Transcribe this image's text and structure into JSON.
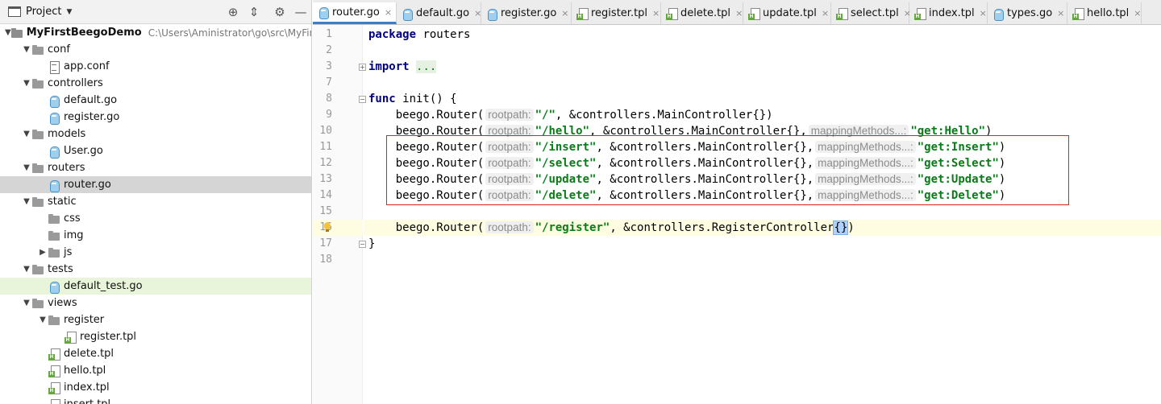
{
  "project_panel": {
    "title": "Project",
    "caret": "▼",
    "tools": [
      "⊕",
      "⇕",
      "⚙",
      "—"
    ]
  },
  "tree": [
    {
      "label": "MyFirstBeegoDemo",
      "path": "C:\\Users\\Aministrator\\go\\src\\MyFirstB",
      "indent": 0,
      "arrow": "▼",
      "icon": "root",
      "bold": true
    },
    {
      "label": "conf",
      "indent": 1,
      "arrow": "▼",
      "icon": "folder"
    },
    {
      "label": "app.conf",
      "indent": 2,
      "arrow": "",
      "icon": "conf"
    },
    {
      "label": "controllers",
      "indent": 1,
      "arrow": "▼",
      "icon": "folder"
    },
    {
      "label": "default.go",
      "indent": 2,
      "arrow": "",
      "icon": "go"
    },
    {
      "label": "register.go",
      "indent": 2,
      "arrow": "",
      "icon": "go"
    },
    {
      "label": "models",
      "indent": 1,
      "arrow": "▼",
      "icon": "folder"
    },
    {
      "label": "User.go",
      "indent": 2,
      "arrow": "",
      "icon": "go"
    },
    {
      "label": "routers",
      "indent": 1,
      "arrow": "▼",
      "icon": "folder"
    },
    {
      "label": "router.go",
      "indent": 2,
      "arrow": "",
      "icon": "go",
      "state": "selected"
    },
    {
      "label": "static",
      "indent": 1,
      "arrow": "▼",
      "icon": "folder"
    },
    {
      "label": "css",
      "indent": 2,
      "arrow": "",
      "icon": "folder"
    },
    {
      "label": "img",
      "indent": 2,
      "arrow": "",
      "icon": "folder"
    },
    {
      "label": "js",
      "indent": 2,
      "arrow": "▶",
      "icon": "folder"
    },
    {
      "label": "tests",
      "indent": 1,
      "arrow": "▼",
      "icon": "folder"
    },
    {
      "label": "default_test.go",
      "indent": 2,
      "arrow": "",
      "icon": "go",
      "state": "modified"
    },
    {
      "label": "views",
      "indent": 1,
      "arrow": "▼",
      "icon": "folder"
    },
    {
      "label": "register",
      "indent": 2,
      "arrow": "▼",
      "icon": "folder"
    },
    {
      "label": "register.tpl",
      "indent": 3,
      "arrow": "",
      "icon": "tpl"
    },
    {
      "label": "delete.tpl",
      "indent": 2,
      "arrow": "",
      "icon": "tpl"
    },
    {
      "label": "hello.tpl",
      "indent": 2,
      "arrow": "",
      "icon": "tpl"
    },
    {
      "label": "index.tpl",
      "indent": 2,
      "arrow": "",
      "icon": "tpl"
    },
    {
      "label": "insert.tpl",
      "indent": 2,
      "arrow": "",
      "icon": "tpl"
    }
  ],
  "tabs": [
    {
      "label": "router.go",
      "icon": "go",
      "active": true
    },
    {
      "label": "default.go",
      "icon": "go"
    },
    {
      "label": "register.go",
      "icon": "go"
    },
    {
      "label": "register.tpl",
      "icon": "tpl"
    },
    {
      "label": "delete.tpl",
      "icon": "tpl"
    },
    {
      "label": "update.tpl",
      "icon": "tpl"
    },
    {
      "label": "select.tpl",
      "icon": "tpl"
    },
    {
      "label": "index.tpl",
      "icon": "tpl"
    },
    {
      "label": "types.go",
      "icon": "go"
    },
    {
      "label": "hello.tpl",
      "icon": "tpl"
    }
  ],
  "tab_close": "×",
  "line_numbers": [
    "1",
    "2",
    "3",
    "7",
    "8",
    "9",
    "10",
    "11",
    "12",
    "13",
    "14",
    "15",
    "16",
    "17",
    "18"
  ],
  "code_lines": [
    [
      {
        "t": "package",
        "c": "kw"
      },
      {
        "t": " routers",
        "c": "fn"
      }
    ],
    [],
    [
      {
        "t": "import",
        "c": "kw"
      },
      {
        "t": " ",
        "c": "fn"
      },
      {
        "t": "...",
        "c": "fold-ph"
      }
    ],
    [],
    [
      {
        "t": "func",
        "c": "kw"
      },
      {
        "t": " init() {",
        "c": "fn"
      }
    ],
    [
      {
        "t": "    beego.Router(",
        "c": "fn"
      },
      {
        "t": "rootpath:",
        "c": "hint"
      },
      {
        "t": "\"/\"",
        "c": "str"
      },
      {
        "t": ", &controllers.MainController{})",
        "c": "fn"
      }
    ],
    [
      {
        "t": "    beego.Router(",
        "c": "fn"
      },
      {
        "t": "rootpath:",
        "c": "hint"
      },
      {
        "t": "\"/hello\"",
        "c": "str"
      },
      {
        "t": ", &controllers.MainController{},",
        "c": "fn"
      },
      {
        "t": "mappingMethods...:",
        "c": "hint"
      },
      {
        "t": "\"get:Hello\"",
        "c": "str"
      },
      {
        "t": ")",
        "c": "fn"
      }
    ],
    [
      {
        "t": "    beego.Router(",
        "c": "fn"
      },
      {
        "t": "rootpath:",
        "c": "hint"
      },
      {
        "t": "\"/insert\"",
        "c": "str"
      },
      {
        "t": ", &controllers.MainController{},",
        "c": "fn"
      },
      {
        "t": "mappingMethods...:",
        "c": "hint"
      },
      {
        "t": "\"get:Insert\"",
        "c": "str"
      },
      {
        "t": ")",
        "c": "fn"
      }
    ],
    [
      {
        "t": "    beego.Router(",
        "c": "fn"
      },
      {
        "t": "rootpath:",
        "c": "hint"
      },
      {
        "t": "\"/select\"",
        "c": "str"
      },
      {
        "t": ", &controllers.MainController{},",
        "c": "fn"
      },
      {
        "t": "mappingMethods...:",
        "c": "hint"
      },
      {
        "t": "\"get:Select\"",
        "c": "str"
      },
      {
        "t": ")",
        "c": "fn"
      }
    ],
    [
      {
        "t": "    beego.Router(",
        "c": "fn"
      },
      {
        "t": "rootpath:",
        "c": "hint"
      },
      {
        "t": "\"/update\"",
        "c": "str"
      },
      {
        "t": ", &controllers.MainController{},",
        "c": "fn"
      },
      {
        "t": "mappingMethods...:",
        "c": "hint"
      },
      {
        "t": "\"get:Update\"",
        "c": "str"
      },
      {
        "t": ")",
        "c": "fn"
      }
    ],
    [
      {
        "t": "    beego.Router(",
        "c": "fn"
      },
      {
        "t": "rootpath:",
        "c": "hint"
      },
      {
        "t": "\"/delete\"",
        "c": "str"
      },
      {
        "t": ", &controllers.MainController{},",
        "c": "fn"
      },
      {
        "t": "mappingMethods...:",
        "c": "hint"
      },
      {
        "t": "\"get:Delete\"",
        "c": "str"
      },
      {
        "t": ")",
        "c": "fn"
      }
    ],
    [],
    [
      {
        "t": "    beego.Router(",
        "c": "fn"
      },
      {
        "t": "rootpath:",
        "c": "hint"
      },
      {
        "t": "\"/register\"",
        "c": "str"
      },
      {
        "t": ", &controllers.RegisterController",
        "c": "fn"
      },
      {
        "t": "{}",
        "c": "brace-hl"
      },
      {
        "t": ")",
        "c": "fn"
      }
    ],
    [
      {
        "t": "}",
        "c": "fn"
      }
    ],
    []
  ],
  "current_line_number": "16",
  "highlighted_line_numbers": [
    "11",
    "12",
    "13",
    "14"
  ],
  "colors": {
    "highlight_box": "#e0201f",
    "active_tab_underline": "#3f7ec4",
    "string": "#067d17",
    "keyword": "#000080"
  }
}
